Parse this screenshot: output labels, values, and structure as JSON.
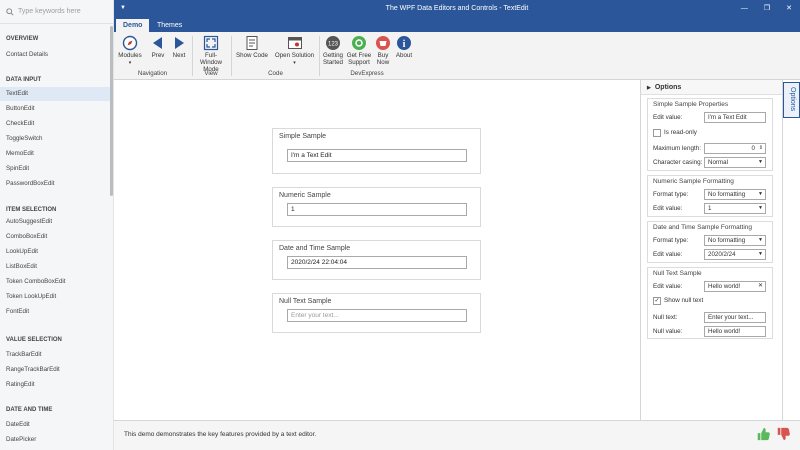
{
  "sidebar": {
    "search_placeholder": "Type keywords here",
    "sections": [
      {
        "label": "OVERVIEW",
        "items": [
          {
            "label": "Contact Details"
          }
        ]
      },
      {
        "label": "DATA INPUT",
        "items": [
          {
            "label": "TextEdit",
            "selected": true
          },
          {
            "label": "ButtonEdit"
          },
          {
            "label": "CheckEdit"
          },
          {
            "label": "ToggleSwitch"
          },
          {
            "label": "MemoEdit"
          },
          {
            "label": "SpinEdit"
          },
          {
            "label": "PasswordBoxEdit"
          }
        ]
      },
      {
        "label": "ITEM SELECTION",
        "items": [
          {
            "label": "AutoSuggestEdit"
          },
          {
            "label": "ComboBoxEdit"
          },
          {
            "label": "LookUpEdit"
          },
          {
            "label": "ListBoxEdit"
          },
          {
            "label": "Token ComboBoxEdit"
          },
          {
            "label": "Token LookUpEdit"
          },
          {
            "label": "FontEdit"
          }
        ]
      },
      {
        "label": "VALUE SELECTION",
        "items": [
          {
            "label": "TrackBarEdit"
          },
          {
            "label": "RangeTrackBarEdit"
          },
          {
            "label": "RatingEdit"
          }
        ]
      },
      {
        "label": "DATE AND TIME",
        "items": [
          {
            "label": "DateEdit"
          },
          {
            "label": "DatePicker"
          }
        ]
      }
    ]
  },
  "window": {
    "title": "The WPF Data Editors and Controls - TextEdit"
  },
  "ribbon": {
    "tabs": [
      "Demo",
      "Themes"
    ],
    "buttons": {
      "modules": "Modules",
      "prev": "Prev",
      "next": "Next",
      "fullwindow_1": "Full-Window",
      "fullwindow_2": "Mode",
      "show_code": "Show Code",
      "open_solution": "Open Solution",
      "getting_started_1": "Getting",
      "getting_started_2": "Started",
      "free_support_1": "Get Free",
      "free_support_2": "Support",
      "buy_now_1": "Buy",
      "buy_now_2": "Now",
      "about": "About"
    },
    "groups": {
      "navigation": "Navigation",
      "view": "View",
      "code": "Code",
      "devexpress": "DevExpress"
    }
  },
  "samples": {
    "simple": {
      "title": "Simple Sample",
      "value": "I'm a Text Edit"
    },
    "numeric": {
      "title": "Numeric Sample",
      "value": "1"
    },
    "datetime": {
      "title": "Date and Time Sample",
      "value": "2020/2/24 22:04:04"
    },
    "nulltext": {
      "title": "Null Text Sample",
      "placeholder": "Enter your text..."
    }
  },
  "options": {
    "header": "Options",
    "vertical_tab": "Options",
    "simple": {
      "title": "Simple Sample Properties",
      "edit_value_label": "Edit value:",
      "edit_value": "I'm a Text Edit",
      "readonly_label": "Is read-only",
      "max_length_label": "Maximum length:",
      "max_length": "0",
      "casing_label": "Character casing:",
      "casing": "Normal"
    },
    "numeric": {
      "title": "Numeric Sample Formatting",
      "format_label": "Format type:",
      "format": "No formatting",
      "edit_value_label": "Edit value:",
      "edit_value": "1"
    },
    "datetime": {
      "title": "Date and Time Sample Formatting",
      "format_label": "Format type:",
      "format": "No formatting",
      "edit_value_label": "Edit value:",
      "edit_value": "2020/2/24"
    },
    "nulltext": {
      "title": "Null Text Sample",
      "edit_value_label": "Edit value:",
      "edit_value": "Hello world!",
      "show_null_label": "Show null text",
      "null_text_label": "Null text:",
      "null_text": "Enter your text...",
      "null_value_label": "Null value:",
      "null_value": "Hello world!"
    }
  },
  "status": {
    "message": "This demo demonstrates the key features provided by a text editor."
  },
  "colors": {
    "accent": "#2b579a",
    "selected_item": "#dfe9f5"
  }
}
